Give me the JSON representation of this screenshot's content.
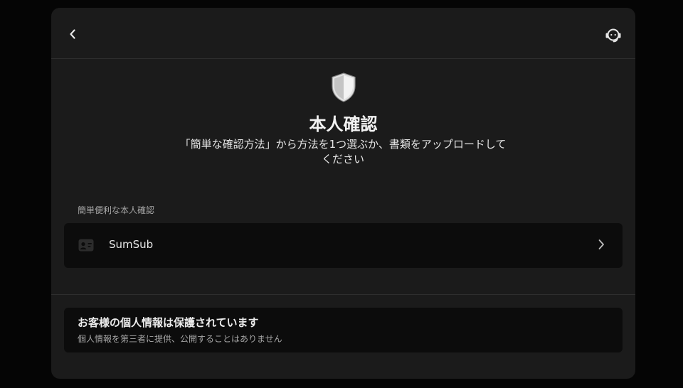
{
  "page": {
    "title": "本人確認",
    "subtitle": "「簡単な確認方法」から方法を1つ選ぶか、書類をアップロードしてください"
  },
  "icons": {
    "back": "chevron-left-icon",
    "support": "headset-support-icon",
    "hero": "shield-icon",
    "option": "id-card-icon",
    "option_arrow": "chevron-right-icon"
  },
  "section": {
    "label": "簡単便利な本人確認",
    "options": [
      {
        "label": "SumSub"
      }
    ]
  },
  "privacy": {
    "title": "お客様の個人情報は保護されています",
    "description": "個人情報を第三者に提供、公開することはありません"
  },
  "colors": {
    "background": "#050505",
    "panel": "#1b1b1b",
    "card": "#0c0c0c",
    "text_primary": "#e8e8e8",
    "text_secondary": "#a8a8a8"
  }
}
